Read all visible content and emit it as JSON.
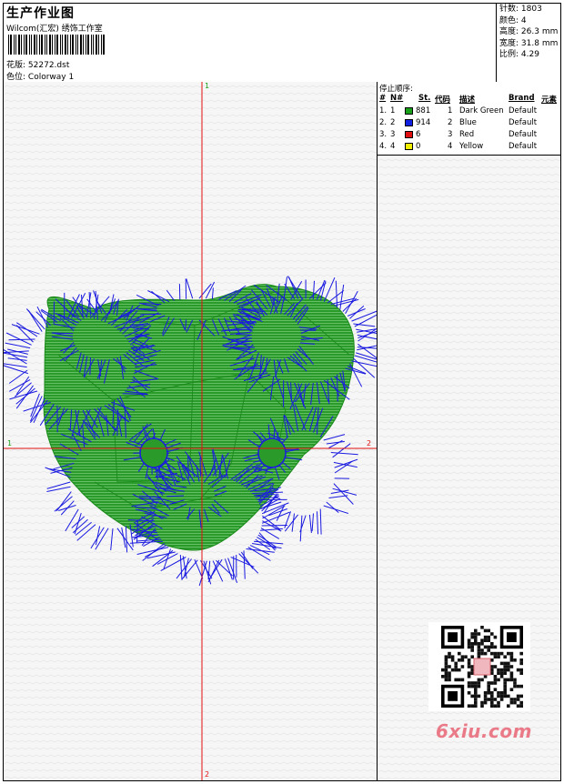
{
  "header": {
    "title": "生产作业图",
    "company": "Wilcom(汇宏) 绣饰工作室",
    "file_label": "花版:",
    "file_value": "52272.dst",
    "colorway_label": "色位:",
    "colorway_value": "Colorway 1"
  },
  "stats": [
    {
      "label": "针数:",
      "value": "1803"
    },
    {
      "label": "颜色:",
      "value": "4"
    },
    {
      "label": "高度:",
      "value": "26.3 mm"
    },
    {
      "label": "宽度:",
      "value": "31.8 mm"
    },
    {
      "label": "比例:",
      "value": "4.29"
    }
  ],
  "stop_sequence": {
    "title": "停止顺序:",
    "headers": [
      "#",
      "N#",
      "St.",
      "代码",
      "描述",
      "Brand",
      "元素"
    ],
    "rows": [
      {
        "num": "1.",
        "n": "1",
        "color": "#18a018",
        "st": "881",
        "code": "1",
        "desc": "Dark Green",
        "brand": "Default"
      },
      {
        "num": "2.",
        "n": "2",
        "color": "#1020e0",
        "st": "914",
        "code": "2",
        "desc": "Blue",
        "brand": "Default"
      },
      {
        "num": "3.",
        "n": "3",
        "color": "#e01010",
        "st": "6",
        "code": "3",
        "desc": "Red",
        "brand": "Default"
      },
      {
        "num": "4.",
        "n": "4",
        "color": "#f0f000",
        "st": "0",
        "code": "4",
        "desc": "Yellow",
        "brand": "Default"
      }
    ]
  },
  "axes": {
    "top": "1",
    "bottom": "2",
    "left": "1",
    "right": "2"
  },
  "colors": {
    "fill_green": "#27a027",
    "outline_blue": "#1a1ae0",
    "axis_red": "#e01010"
  },
  "watermark": "6xiu.com"
}
